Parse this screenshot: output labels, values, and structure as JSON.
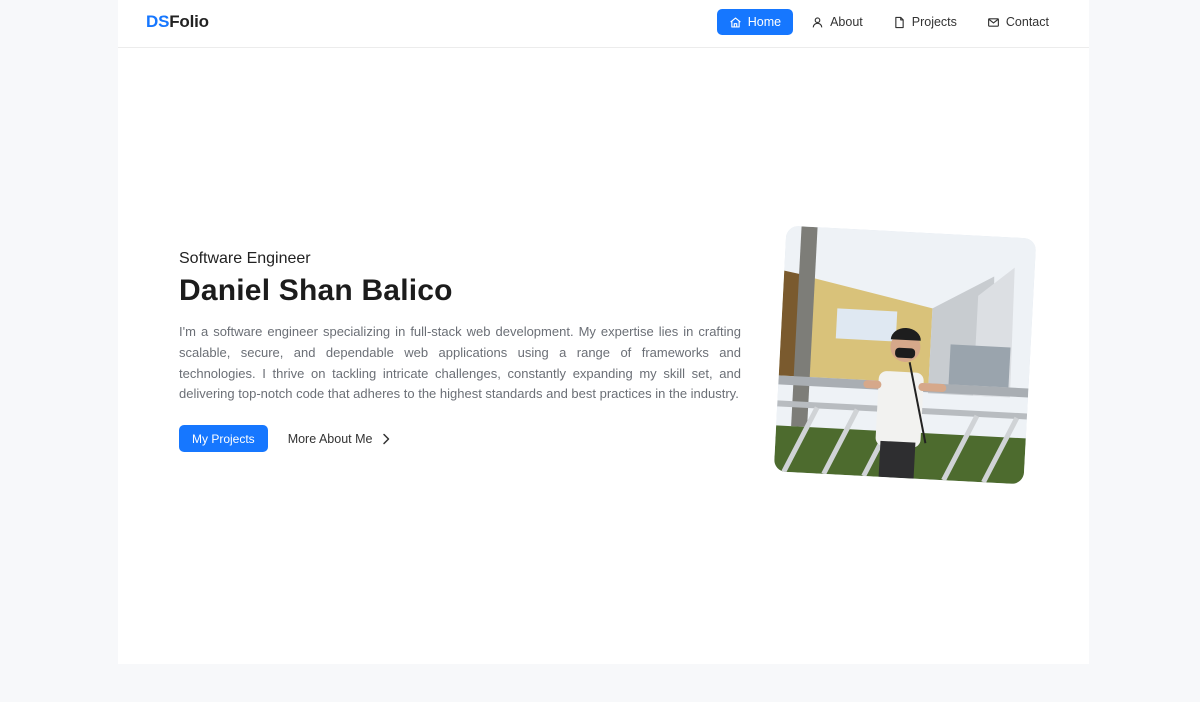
{
  "brand": {
    "prefix": "DS",
    "suffix": "Folio"
  },
  "nav": {
    "items": [
      {
        "label": "Home",
        "icon": "home-icon",
        "active": true
      },
      {
        "label": "About",
        "icon": "user-icon",
        "active": false
      },
      {
        "label": "Projects",
        "icon": "document-icon",
        "active": false
      },
      {
        "label": "Contact",
        "icon": "mail-icon",
        "active": false
      }
    ]
  },
  "hero": {
    "role": "Software Engineer",
    "name": "Daniel Shan Balico",
    "bio": "I'm a software engineer specializing in full-stack web development. My expertise lies in crafting scalable, secure, and dependable web applications using a range of frameworks and technologies. I thrive on tackling intricate challenges, constantly expanding my skill set, and delivering top-notch code that adheres to the highest standards and best practices in the industry.",
    "primary_button": "My Projects",
    "secondary_button": "More About Me",
    "secondary_icon": "chevron-right-icon"
  },
  "colors": {
    "accent": "#1677ff",
    "background": "#f7f8fa",
    "card": "#ffffff",
    "body_text": "#6b6f76"
  }
}
